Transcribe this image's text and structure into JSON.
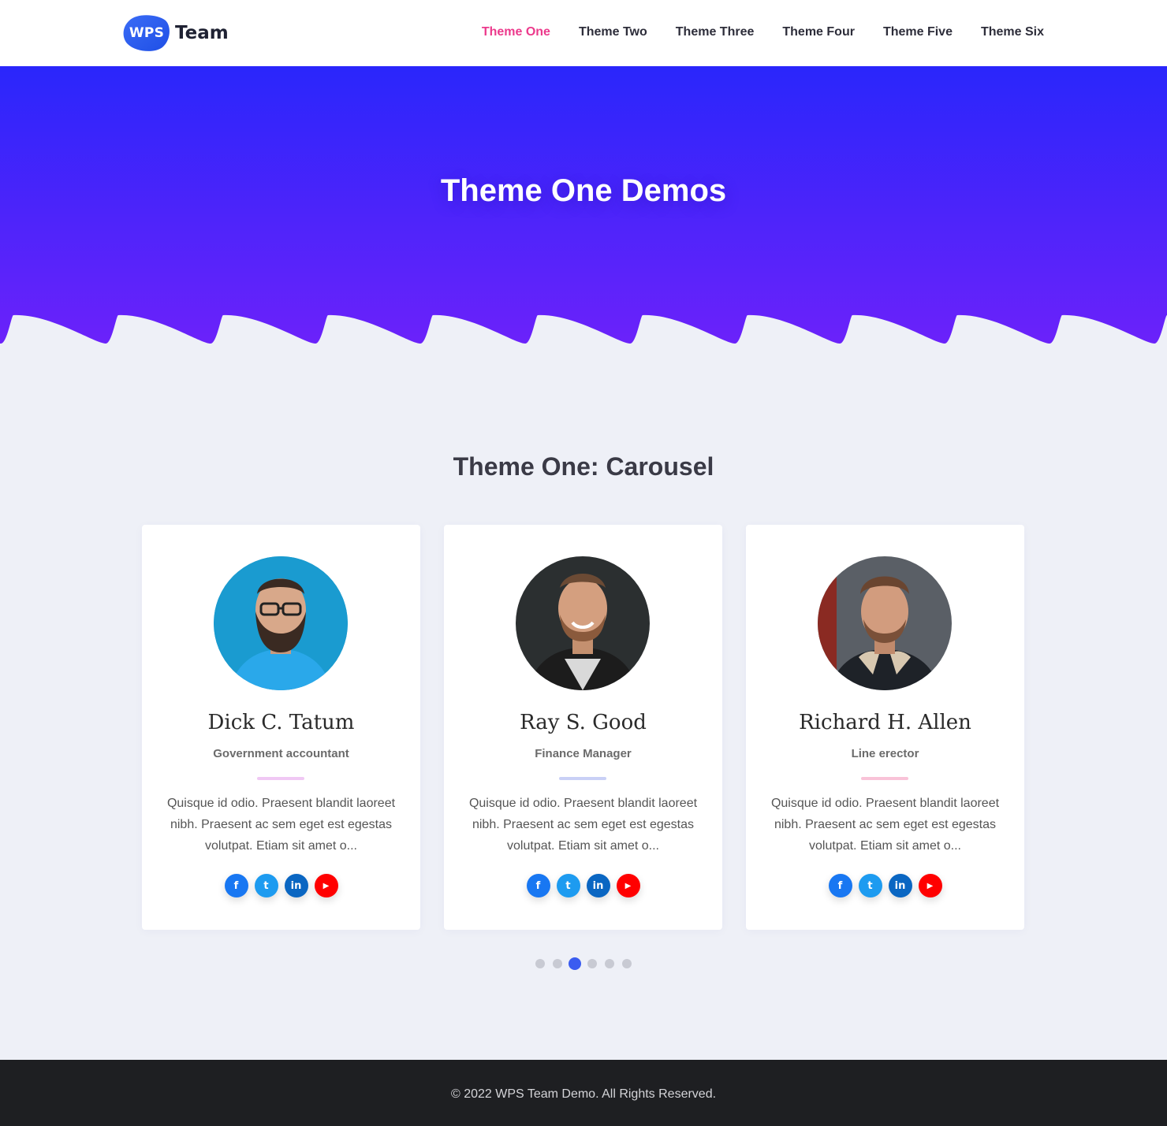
{
  "header": {
    "logo_badge": "WPS",
    "logo_text": "Team",
    "nav": [
      {
        "label": "Theme One",
        "active": true
      },
      {
        "label": "Theme Two"
      },
      {
        "label": "Theme Three"
      },
      {
        "label": "Theme Four"
      },
      {
        "label": "Theme Five"
      },
      {
        "label": "Theme Six"
      }
    ]
  },
  "hero": {
    "title": "Theme One Demos",
    "colors": {
      "top": "#2a26fb",
      "bottom": "#6b22fa"
    }
  },
  "section": {
    "title": "Theme One: Carousel"
  },
  "members": [
    {
      "name": "Dick C. Tatum",
      "role": "Government accountant",
      "bio": "Quisque id odio. Praesent blandit laoreet nibh. Praesent ac sem eget est egestas volutpat. Etiam sit amet o...",
      "divider_color": "#f0c8f4",
      "socials": [
        {
          "icon": "facebook-icon",
          "glyph": "f",
          "color": "#1877f2"
        },
        {
          "icon": "twitter-icon",
          "glyph": "t",
          "color": "#1d9bf0"
        },
        {
          "icon": "linkedin-icon",
          "glyph": "in",
          "color": "#0a66c2"
        },
        {
          "icon": "youtube-icon",
          "glyph": "▶",
          "color": "#ff0000"
        }
      ]
    },
    {
      "name": "Ray S. Good",
      "role": "Finance Manager",
      "bio": "Quisque id odio. Praesent blandit laoreet nibh. Praesent ac sem eget est egestas volutpat. Etiam sit amet o...",
      "divider_color": "#c9d0f6",
      "socials": [
        {
          "icon": "facebook-icon",
          "glyph": "f",
          "color": "#1877f2"
        },
        {
          "icon": "twitter-icon",
          "glyph": "t",
          "color": "#1d9bf0"
        },
        {
          "icon": "linkedin-icon",
          "glyph": "in",
          "color": "#0a66c2"
        },
        {
          "icon": "youtube-icon",
          "glyph": "▶",
          "color": "#ff0000"
        }
      ]
    },
    {
      "name": "Richard H. Allen",
      "role": "Line erector",
      "bio": "Quisque id odio. Praesent blandit laoreet nibh. Praesent ac sem eget est egestas volutpat. Etiam sit amet o...",
      "divider_color": "#f9c3d8",
      "socials": [
        {
          "icon": "facebook-icon",
          "glyph": "f",
          "color": "#1877f2"
        },
        {
          "icon": "twitter-icon",
          "glyph": "t",
          "color": "#1d9bf0"
        },
        {
          "icon": "linkedin-icon",
          "glyph": "in",
          "color": "#0a66c2"
        },
        {
          "icon": "youtube-icon",
          "glyph": "▶",
          "color": "#ff0000"
        }
      ]
    }
  ],
  "carousel": {
    "dot_count": 6,
    "active_index": 2
  },
  "footer": {
    "text": "© 2022 WPS Team Demo. All Rights Reserved."
  }
}
